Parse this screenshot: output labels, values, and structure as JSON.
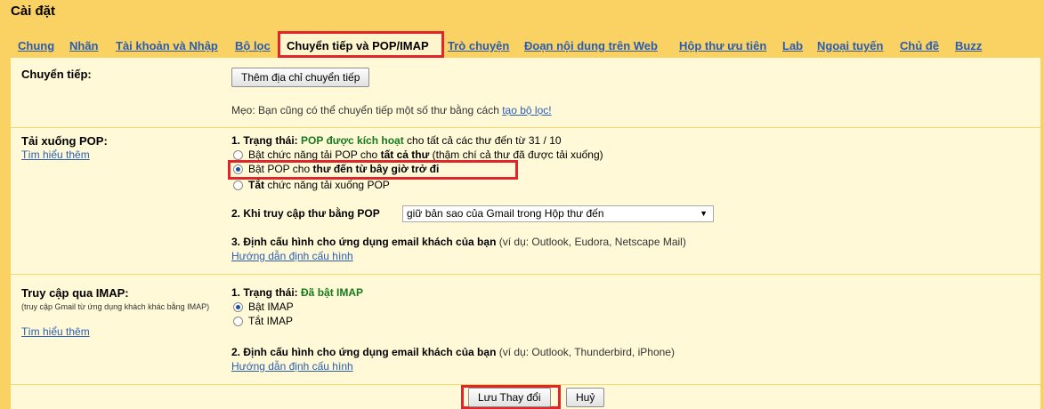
{
  "page": {
    "title": "Cài đặt"
  },
  "tabs": [
    {
      "label": "Chung"
    },
    {
      "label": "Nhãn"
    },
    {
      "label": "Tài khoản và Nhập"
    },
    {
      "label": "Bộ lọc"
    },
    {
      "label": "Chuyển tiếp và POP/IMAP",
      "active": true
    },
    {
      "label": "Trò chuyện"
    },
    {
      "label": "Đoạn nội dung trên Web"
    },
    {
      "label": "Hộp thư ưu tiên"
    },
    {
      "label": "Lab"
    },
    {
      "label": "Ngoại tuyến"
    },
    {
      "label": "Chủ đề"
    },
    {
      "label": "Buzz"
    }
  ],
  "forwarding": {
    "label": "Chuyển tiếp:",
    "add_button": "Thêm địa chỉ chuyển tiếp",
    "tip_text": "Mẹo: Bạn cũng có thể chuyển tiếp một số thư bằng cách ",
    "tip_link": "tạo bộ lọc!"
  },
  "pop": {
    "label": "Tải xuống POP:",
    "learn_more": "Tìm hiểu thêm",
    "status_prefix": "1. Trạng thái: ",
    "status_value": "POP được kích hoạt",
    "status_suffix": " cho tất cả các thư đến từ 31 / 10",
    "option1_a": "Bật chức năng tải POP cho ",
    "option1_b": "tất cả thư",
    "option1_c": " (thậm chí cả thư đã được tải xuống)",
    "option2_a": "Bật POP cho ",
    "option2_b": "thư đến từ bây giờ trở đi",
    "option3_a": "Tắt",
    "option3_b": " chức năng tải xuống POP",
    "access_label": "2. Khi truy cập thư bằng POP",
    "access_value": "giữ bản sao của Gmail trong Hộp thư đến",
    "config_label": "3. Định cấu hình cho ứng dụng email khách của bạn",
    "config_hint": " (ví dụ: Outlook, Eudora, Netscape Mail)",
    "config_link": "Hướng dẫn định cấu hình"
  },
  "imap": {
    "label": "Truy cập qua IMAP:",
    "sub": "(truy cập Gmail từ ứng dụng khách khác bằng IMAP)",
    "learn_more": "Tìm hiểu thêm",
    "status_prefix": "1. Trạng thái: ",
    "status_value": "Đã bật IMAP",
    "enable": "Bật IMAP",
    "disable": "Tắt IMAP",
    "config_label": "2. Định cấu hình cho ứng dụng email khách của bạn",
    "config_hint": " (ví dụ: Outlook, Thunderbird, iPhone)",
    "config_link": "Hướng dẫn định cấu hình"
  },
  "footer": {
    "save": "Lưu Thay đổi",
    "cancel": "Huỷ"
  },
  "colors": {
    "accent_frame": "#fad163",
    "content_bg": "#fff9d7",
    "link": "#2a5db0",
    "status_green": "#167a1d",
    "highlight_red": "#e0262a"
  }
}
